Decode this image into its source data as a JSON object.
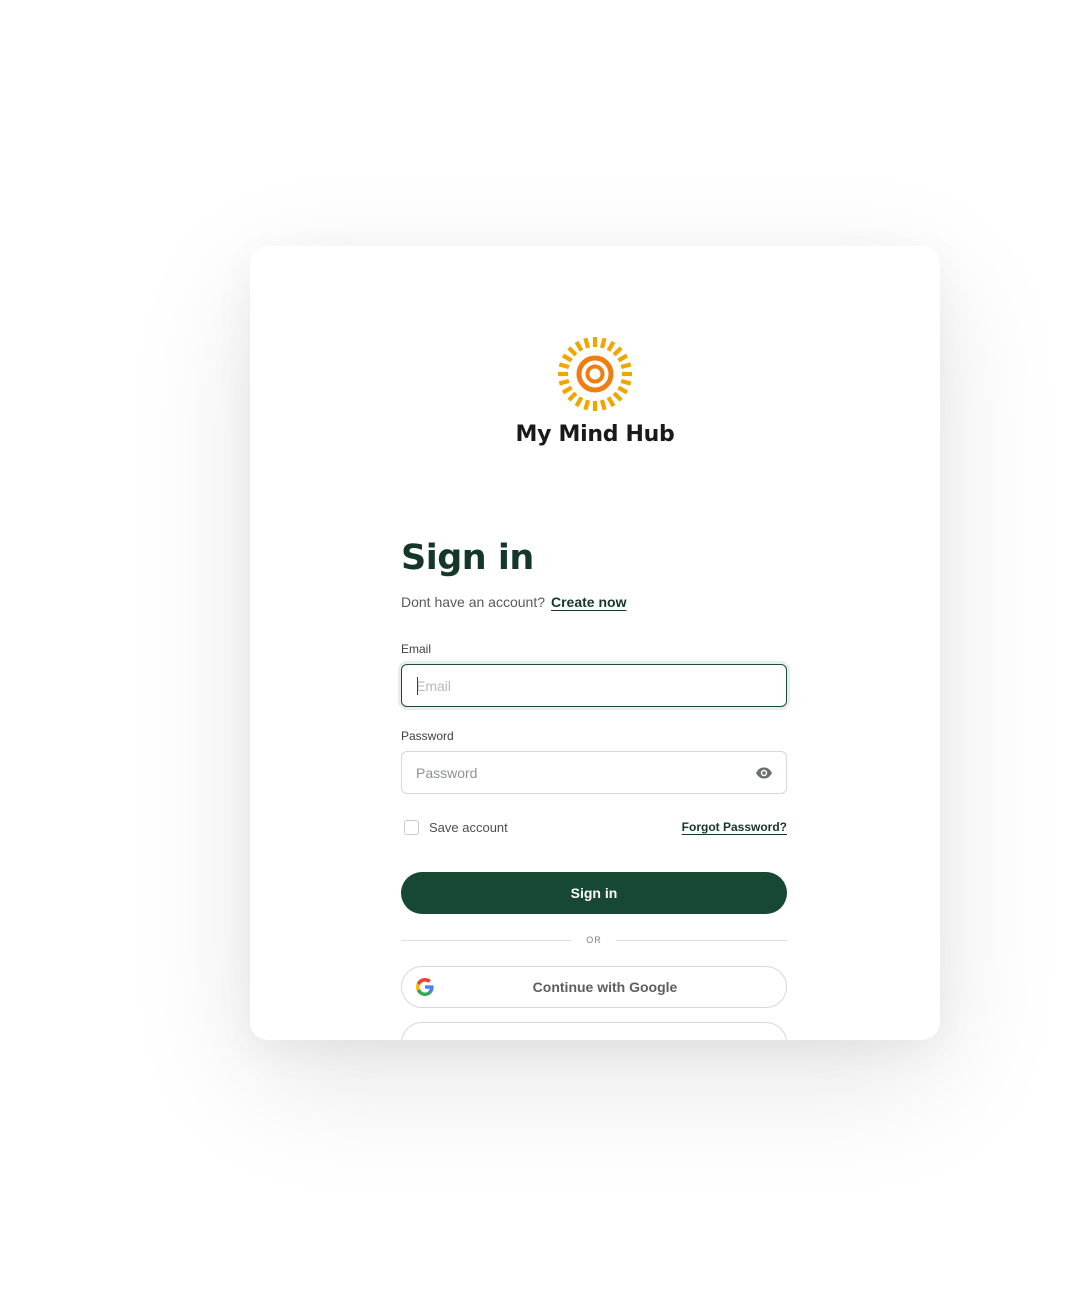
{
  "brand": {
    "name": "My Mind Hub",
    "logo_icon": "sun-rings-logo",
    "logo_colors": [
      "#f0a500",
      "#ef7d12"
    ]
  },
  "signin": {
    "title": "Sign in",
    "no_account_text": "Dont have an account?",
    "create_link": "Create now"
  },
  "email": {
    "label": "Email",
    "placeholder": "Email",
    "value": ""
  },
  "password": {
    "label": "Password",
    "placeholder": "Password",
    "value": "",
    "toggle_icon": "eye-icon"
  },
  "options": {
    "save_account_label": "Save account",
    "save_account_checked": false,
    "forgot_password": "Forgot Password?"
  },
  "actions": {
    "signin_button": "Sign in",
    "divider_text": "OR",
    "google_button": "Continue with Google",
    "google_icon": "google-icon"
  },
  "colors": {
    "primary": "#164834",
    "heading": "#14372a"
  }
}
